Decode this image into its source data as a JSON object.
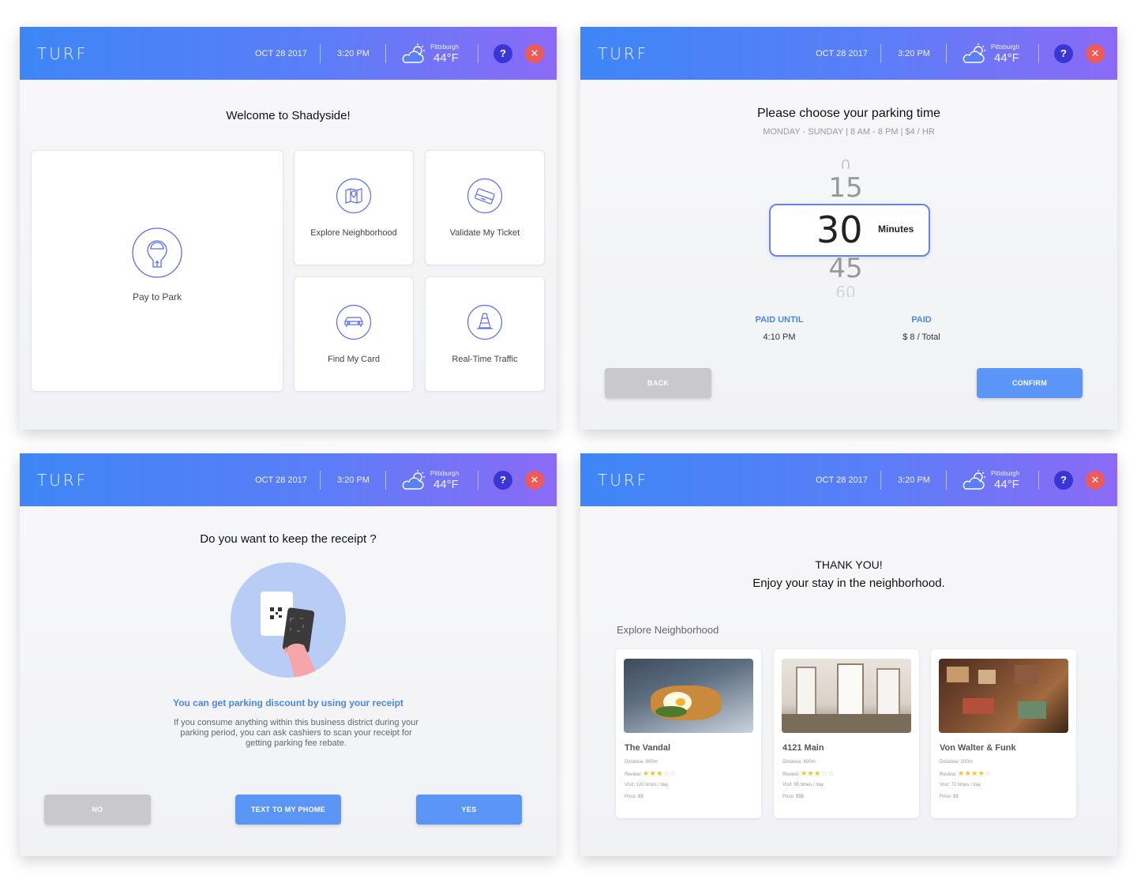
{
  "header": {
    "logo": "TURF",
    "date": "OCT 28 2017",
    "time": "3:20 PM",
    "weather_city": "Pittsburgh",
    "weather_temp": "44°F",
    "weather_icon": "partly-cloudy-icon",
    "help_label": "?",
    "close_label": "✕"
  },
  "colors": {
    "header_gradient": [
      "#3e86f5",
      "#8b6af6"
    ],
    "primary_button": "#5b96f6",
    "secondary_button": "#c9c9cc",
    "help": "#3a35d6",
    "close": "#ec5b57",
    "accent_text": "#4a87ea"
  },
  "welcome": {
    "title": "Welcome to Shadyside!",
    "tiles": [
      {
        "label": "Pay to Park",
        "icon": "parking-meter-icon"
      },
      {
        "label": "Explore Neighborhood",
        "icon": "map-icon"
      },
      {
        "label": "Validate My Ticket",
        "icon": "ticket-icon"
      },
      {
        "label": "Find My Card",
        "icon": "car-icon"
      },
      {
        "label": "Real-Time Traffic",
        "icon": "traffic-cone-icon"
      }
    ]
  },
  "parking": {
    "title": "Please choose your parking time",
    "subtitle": "MONDAY - SUNDAY |  8 AM - 8 PM  |   $4 / HR",
    "picker_values": [
      "0",
      "15",
      "30",
      "45",
      "60"
    ],
    "selected": "30",
    "unit": "Minutes",
    "paid_until_label": "PAID UNTIL",
    "paid_until_value": "4:10 PM",
    "paid_label": "PAID",
    "paid_value": "$ 8 / Total",
    "back_label": "BACK",
    "confirm_label": "CONFIRM"
  },
  "receipt": {
    "title": "Do you want to keep the receipt ?",
    "highlight": "You can get parking discount by using your receipt",
    "body": "If you consume anything within this business district during your parking period, you can ask cashiers to scan your receipt for getting parking fee rebate.",
    "no_label": "NO",
    "text_label": "TEXT TO MY PHOME",
    "yes_label": "YES"
  },
  "thanks": {
    "title": "THANK YOU!",
    "subtitle": "Enjoy your stay in the neighborhood.",
    "section": "Explore Neighborhood",
    "places": [
      {
        "name": "The Vandal",
        "distance": "Distance: 800m",
        "review_label": "Review:",
        "rating": 3,
        "visit": "Visit: 120 times / day",
        "price": "Price: $$"
      },
      {
        "name": "4121 Main",
        "distance": "Distance: 600m",
        "review_label": "Review:",
        "rating": 3,
        "visit": "Visit: 65 times / day",
        "price": "Price: $$$"
      },
      {
        "name": "Von Walter & Funk",
        "distance": "Distance: 200m",
        "review_label": "Review:",
        "rating": 4,
        "visit": "Visit: 72 times / day",
        "price": "Price: $$"
      }
    ]
  }
}
